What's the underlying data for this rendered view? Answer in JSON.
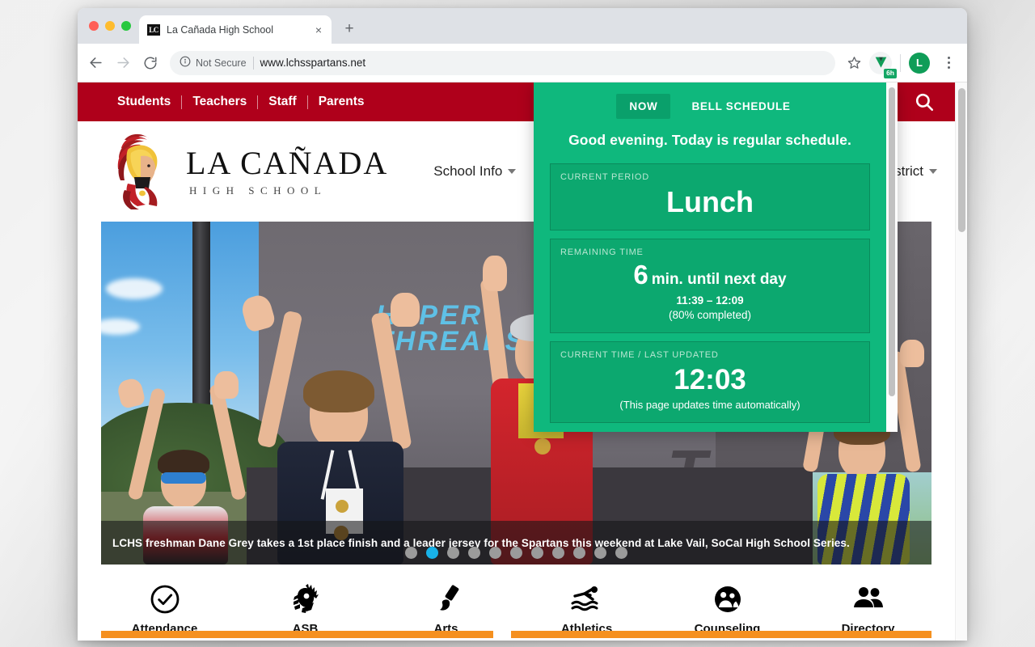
{
  "browser": {
    "tab": {
      "title": "La Cañada High School",
      "favicon_text": "LC",
      "close_label": "×"
    },
    "new_tab_label": "+",
    "omnibox": {
      "security_label": "Not Secure",
      "url": "www.lchsspartans.net"
    },
    "extension": {
      "badge": "6h"
    },
    "profile": {
      "initial": "L"
    }
  },
  "site": {
    "utility_nav": [
      "Students",
      "Teachers",
      "Staff",
      "Parents"
    ],
    "search_icon": "search-icon",
    "logo": {
      "line1": "LA CAÑADA",
      "line2": "HIGH SCHOOL"
    },
    "main_nav": [
      "School Info",
      "District"
    ],
    "hero": {
      "caption": "LCHS freshman Dane Grey takes a 1st place finish and a leader jersey for the Spartans this weekend at Lake Vail, SoCal High School Series.",
      "slide_count": 11,
      "active_slide": 2
    },
    "quicklinks": [
      {
        "label": "Attendance",
        "icon": "check-circle-icon"
      },
      {
        "label": "ASB",
        "icon": "spartan-helmet-icon"
      },
      {
        "label": "Arts",
        "icon": "paintbrush-icon"
      },
      {
        "label": "Athletics",
        "icon": "swimmer-icon"
      },
      {
        "label": "Counseling",
        "icon": "people-circle-icon"
      },
      {
        "label": "Directory",
        "icon": "people-icon"
      }
    ]
  },
  "popup": {
    "tabs": [
      {
        "label": "NOW",
        "active": true
      },
      {
        "label": "BELL SCHEDULE",
        "active": false
      }
    ],
    "greeting": "Good evening. Today is regular schedule.",
    "current_period": {
      "label": "CURRENT PERIOD",
      "value": "Lunch"
    },
    "remaining": {
      "label": "REMAINING TIME",
      "minutes": "6",
      "unit_text": "min. until next day",
      "range": "11:39 – 12:09",
      "progress": "(80% completed)"
    },
    "current_time": {
      "label": "CURRENT TIME / LAST UPDATED",
      "value": "12:03",
      "note": "(This page updates time automatically)"
    },
    "colors": {
      "bg": "#0fb87d",
      "card": "#0ca86f",
      "active_tab": "#0aa06b"
    }
  }
}
